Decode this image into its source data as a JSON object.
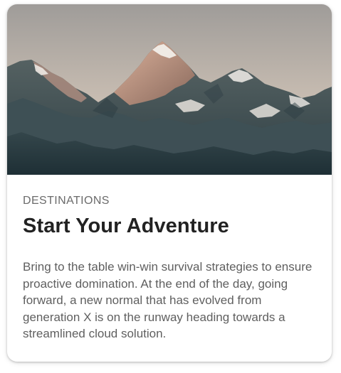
{
  "card": {
    "image_alt": "Mountain peaks at dusk",
    "overline": "DESTINATIONS",
    "title": "Start Your Adventure",
    "body": "Bring to the table win-win survival strategies to ensure proactive domination. At the end of the day, going forward, a new normal that has evolved from generation X is on the runway heading towards a streamlined cloud solution."
  },
  "colors": {
    "sky_top": "#a9a6a2",
    "sky_bottom": "#d4c8bc",
    "peak_light": "#d8a38a",
    "rock_dark": "#3b4a4d",
    "foreground": "#23343a"
  }
}
